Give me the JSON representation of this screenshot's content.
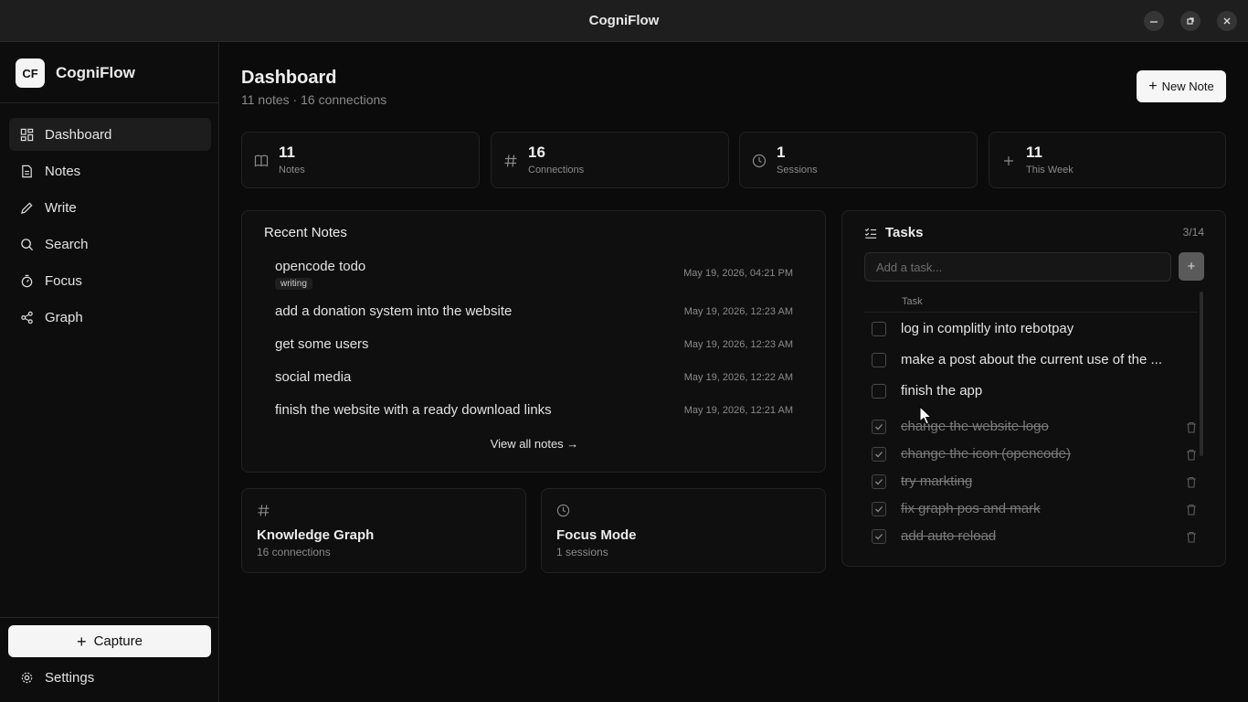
{
  "window": {
    "title": "CogniFlow"
  },
  "sidebar": {
    "logo_text": "CF",
    "app_name": "CogniFlow",
    "items": [
      {
        "label": "Dashboard",
        "icon": "grid-icon",
        "active": true
      },
      {
        "label": "Notes",
        "icon": "document-icon"
      },
      {
        "label": "Write",
        "icon": "pen-icon"
      },
      {
        "label": "Search",
        "icon": "search-icon"
      },
      {
        "label": "Focus",
        "icon": "timer-icon"
      },
      {
        "label": "Graph",
        "icon": "share-icon"
      }
    ],
    "capture_label": "Capture",
    "settings_label": "Settings"
  },
  "header": {
    "title": "Dashboard",
    "subtitle": "11 notes · 16 connections",
    "new_note_label": "New Note"
  },
  "stats": [
    {
      "value": "11",
      "label": "Notes",
      "icon": "book-icon"
    },
    {
      "value": "16",
      "label": "Connections",
      "icon": "hash-icon"
    },
    {
      "value": "1",
      "label": "Sessions",
      "icon": "clock-icon"
    },
    {
      "value": "11",
      "label": "This Week",
      "icon": "plus-icon"
    }
  ],
  "recent_notes": {
    "title": "Recent Notes",
    "items": [
      {
        "title": "opencode todo",
        "date": "May 19, 2026, 04:21 PM",
        "tag": "writing"
      },
      {
        "title": "add a donation system into the website",
        "date": "May 19, 2026, 12:23 AM"
      },
      {
        "title": "get some users",
        "date": "May 19, 2026, 12:23 AM"
      },
      {
        "title": "social media",
        "date": "May 19, 2026, 12:22 AM"
      },
      {
        "title": "finish the website with a ready download links",
        "date": "May 19, 2026, 12:21 AM"
      }
    ],
    "view_all_label": "View all notes →"
  },
  "knowledge_graph": {
    "title": "Knowledge Graph",
    "subtitle": "16 connections"
  },
  "focus_mode": {
    "title": "Focus Mode",
    "subtitle": "1 sessions"
  },
  "tasks": {
    "title": "Tasks",
    "count": "3/14",
    "input_placeholder": "Add a task...",
    "add_label": "+",
    "column_header": "Task",
    "items": [
      {
        "text": "log in complitly into rebotpay",
        "done": false
      },
      {
        "text": "make a post about the current use of the ...",
        "done": false
      },
      {
        "text": "finish the app",
        "done": false
      },
      {
        "text": "change the website logo",
        "done": true
      },
      {
        "text": "change the icon (opencode)",
        "done": true
      },
      {
        "text": "try markting",
        "done": true
      },
      {
        "text": "fix graph pos and mark",
        "done": true
      },
      {
        "text": "add auto reload",
        "done": true
      }
    ]
  },
  "colors": {
    "background": "#0b0b0b",
    "card": "#0f0f0f",
    "accent": "#f5f5f5",
    "muted": "#8a8a8a"
  }
}
